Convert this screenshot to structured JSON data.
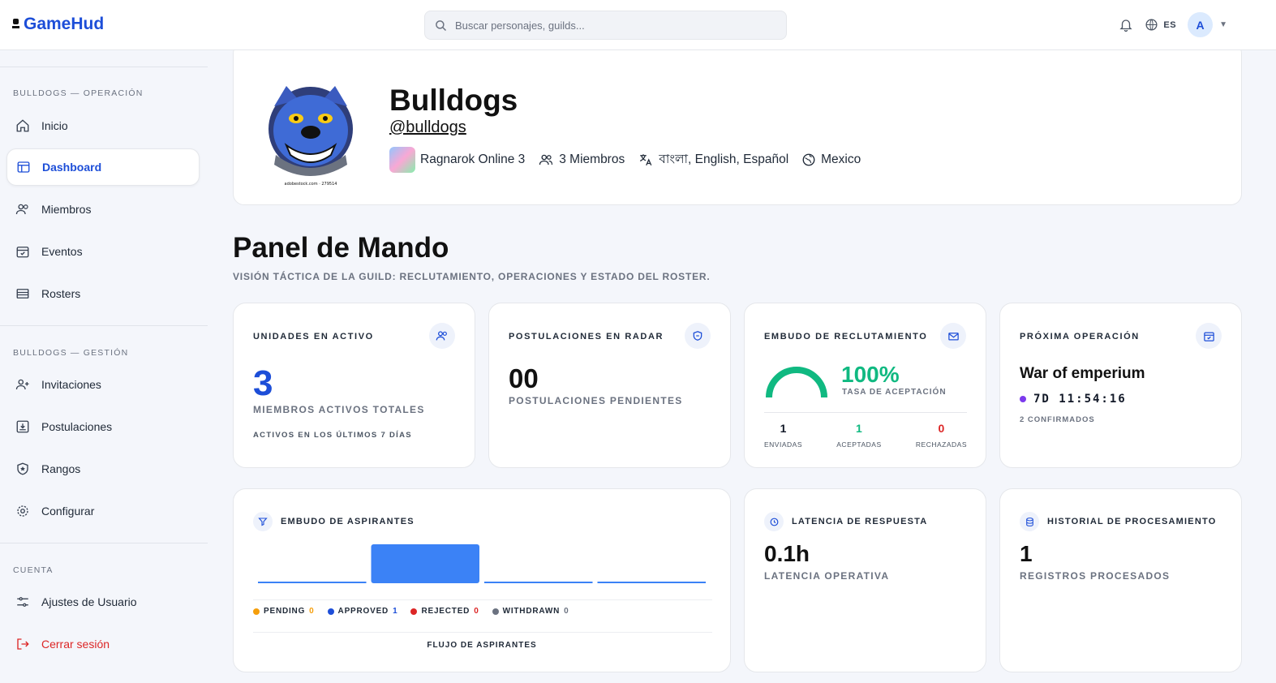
{
  "header": {
    "logo": "GameHud",
    "search_placeholder": "Buscar personajes, guilds...",
    "lang": "ES",
    "avatar": "A"
  },
  "sidebar": {
    "section1": "BULLDOGS — OPERACIÓN",
    "section2": "BULLDOGS — GESTIÓN",
    "section3": "CUENTA",
    "items": [
      {
        "label": "Inicio"
      },
      {
        "label": "Dashboard"
      },
      {
        "label": "Miembros"
      },
      {
        "label": "Eventos"
      },
      {
        "label": "Rosters"
      },
      {
        "label": "Invitaciones"
      },
      {
        "label": "Postulaciones"
      },
      {
        "label": "Rangos"
      },
      {
        "label": "Configurar"
      },
      {
        "label": "Ajustes de Usuario"
      },
      {
        "label": "Cerrar sesión"
      }
    ]
  },
  "guild": {
    "name": "Bulldogs",
    "handle": "@bulldogs",
    "game": "Ragnarok Online 3",
    "members": "3 Miembros",
    "languages": "বাংলা, English, Español",
    "country": "Mexico",
    "logo_watermark": "adobestock.com · 279514"
  },
  "page": {
    "title": "Panel de Mando",
    "subtitle": "VISIÓN TÁCTICA DE LA GUILD: RECLUTAMIENTO, OPERACIONES Y ESTADO DEL ROSTER."
  },
  "cards": {
    "active": {
      "label": "UNIDADES EN ACTIVO",
      "value": "3",
      "sub": "MIEMBROS ACTIVOS TOTALES",
      "note": "ACTIVOS EN LOS ÚLTIMOS 7 DÍAS"
    },
    "applications": {
      "label": "POSTULACIONES EN RADAR",
      "value": "00",
      "sub": "POSTULACIONES PENDIENTES"
    },
    "funnel": {
      "label": "EMBUDO DE RECLUTAMIENTO",
      "rate": "100%",
      "rate_label": "TASA DE ACEPTACIÓN",
      "rate_fraction": 1.0,
      "sent": "1",
      "sent_label": "ENVIADAS",
      "accepted": "1",
      "accepted_label": "ACEPTADAS",
      "rejected": "0",
      "rejected_label": "RECHAZADAS"
    },
    "next_op": {
      "label": "PRÓXIMA OPERACIÓN",
      "name": "War of emperium",
      "countdown": "7D 11:54:16",
      "confirmed": "2 CONFIRMADOS"
    },
    "latency": {
      "label": "LATENCIA DE RESPUESTA",
      "value": "0.1h",
      "sub": "LATENCIA OPERATIVA"
    },
    "history": {
      "label": "HISTORIAL DE PROCESAMIENTO",
      "value": "1",
      "sub": "REGISTROS PROCESADOS"
    }
  },
  "applicants": {
    "label": "EMBUDO DE ASPIRANTES",
    "footer": "FLUJO DE ASPIRANTES",
    "legend": [
      {
        "name": "PENDING",
        "count": "0"
      },
      {
        "name": "APPROVED",
        "count": "1"
      },
      {
        "name": "REJECTED",
        "count": "0"
      },
      {
        "name": "WITHDRAWN",
        "count": "0"
      }
    ]
  },
  "chart_data": {
    "type": "bar",
    "categories": [
      "PENDING",
      "APPROVED",
      "REJECTED",
      "WITHDRAWN"
    ],
    "values": [
      0,
      1,
      0,
      0
    ],
    "colors": [
      "#f59e0b",
      "#3b82f6",
      "#dc2626",
      "#6b7280"
    ],
    "title": "",
    "xlabel": "FLUJO DE ASPIRANTES",
    "ylabel": ""
  },
  "colors": {
    "accent": "#1d4ed8",
    "success": "#10b981",
    "danger": "#dc2626",
    "pending": "#f59e0b",
    "purple": "#7c3aed"
  }
}
